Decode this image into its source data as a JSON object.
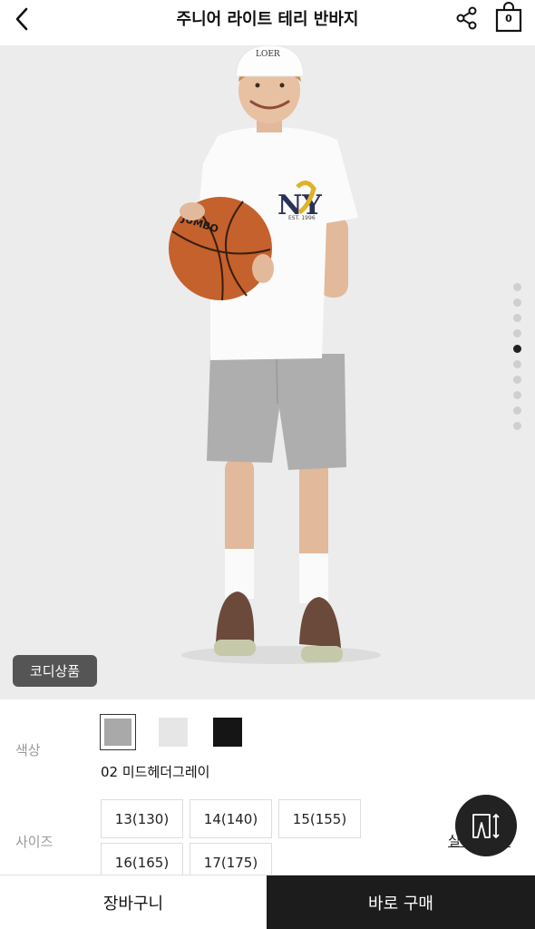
{
  "header": {
    "title": "주니어 라이트 테리 반바지",
    "cart_count": "0"
  },
  "icons": {
    "back": "chevron-left-icon",
    "share": "share-icon",
    "cart": "shopping-bag-icon",
    "size_fab": "size-measure-icon"
  },
  "hero": {
    "codi_tag": "코디상품",
    "carousel": {
      "total": 10,
      "active_index": 4
    },
    "cap_text": "LOER",
    "shirt_logo": "NY",
    "shirt_subtext": "EST. 1996",
    "ball_text": "JUMBO"
  },
  "options": {
    "color_label": "색상",
    "colors": [
      {
        "hex": "#a9a9a9",
        "selected": true
      },
      {
        "hex": "#e6e6e6",
        "selected": false
      },
      {
        "hex": "#151515",
        "selected": false
      }
    ],
    "selected_color_name": "02 미드헤더그레이",
    "size_label": "사이즈",
    "sizes": [
      "13(130)",
      "14(140)",
      "15(155)",
      "16(165)",
      "17(175)"
    ],
    "size_guide": "실측사이즈"
  },
  "bottom": {
    "cart_label": "장바구니",
    "buy_label": "바로 구매"
  }
}
